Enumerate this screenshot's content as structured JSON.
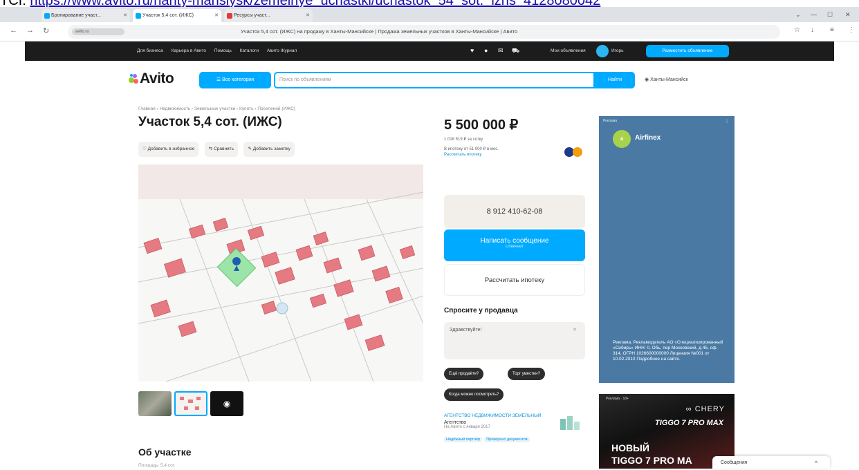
{
  "source": {
    "label": "TCI:",
    "url": "https://www.avito.ru/hanty-mansiysk/zemelnye_uchastki/uchastok_54_sot._izhs_4128080042"
  },
  "browser": {
    "tabs": [
      "Бронирование участ...",
      "Участок 5,4 сот. (ИЖС)",
      "Ресурсы участ..."
    ],
    "window_title": "Участок 5,4 сот. (ИЖС) на продажу в Ханты-Мансийске | Продажа земельных участков в Ханты-Мансийске | Авито",
    "site_chip": "avito.ru"
  },
  "topnav": {
    "links": [
      "Для бизнеса",
      "Карьера в Авито",
      "Помощь",
      "Каталоги",
      "Авито Журнал"
    ],
    "link2": "Мои объявления",
    "username": "Игорь",
    "place_ad": "Разместить объявление"
  },
  "header": {
    "logo": "Avito",
    "categories": "Все категории",
    "search_placeholder": "Поиск по объявлениям",
    "find": "Найти",
    "location": "Ханты-Мансийск"
  },
  "breadcrumbs": "Главная › Недвижимость › Земельные участки › Купить › Поселений (ИЖС)",
  "title": "Участок 5,4 сот. (ИЖС)",
  "actions": [
    "Добавить в избранное",
    "Сравнить",
    "Добавить заметку"
  ],
  "about": {
    "heading": "Об участке",
    "sub": "Площадь: 5,4 сот."
  },
  "price": {
    "amount": "5 500 000 ₽",
    "per_unit": "1 018 519 ₽ за сотку",
    "loan": "В ипотеку от 51 000 ₽ в мес.",
    "loan_link": "Рассчитать ипотеку"
  },
  "contact": {
    "phone": "8 912 410-62-08",
    "write": "Написать сообщение",
    "write_sub": "Отвечает",
    "mortgage": "Рассчитать ипотеку"
  },
  "ask": {
    "heading": "Спросите у продавца",
    "placeholder": "Здравствуйте!",
    "chips": [
      "Ещё продаёте?",
      "Торг уместен?",
      "Когда можно посмотреть?"
    ]
  },
  "seller": {
    "company": "АГЕНТСТВО НЕДВИЖИМОСТИ ЗЕМЕЛЬНЫЙ",
    "name": "Агентство",
    "since": "На Авито с января 2017",
    "tags": [
      "Надёжный партнёр",
      "Проверено документов"
    ]
  },
  "ad1": {
    "label": "Реклама",
    "brand": "Airfinex",
    "text": "Реклама. Рекламодатель АО «Специализированный «Сибирь» ИНН: 0, Обь, пер Московский, д.45, оф. 314, ОГРН 1026600000000 Лицензия №001 от 10.02.2010 Подробнее на сайте."
  },
  "ad2": {
    "label": "Реклама · 18+",
    "brand": "CHERY",
    "model_short": "TIGGO 7 PRO MAX",
    "new": "НОВЫЙ",
    "model": "TIGGO 7 PRO MA"
  },
  "messages": "Сообщения"
}
